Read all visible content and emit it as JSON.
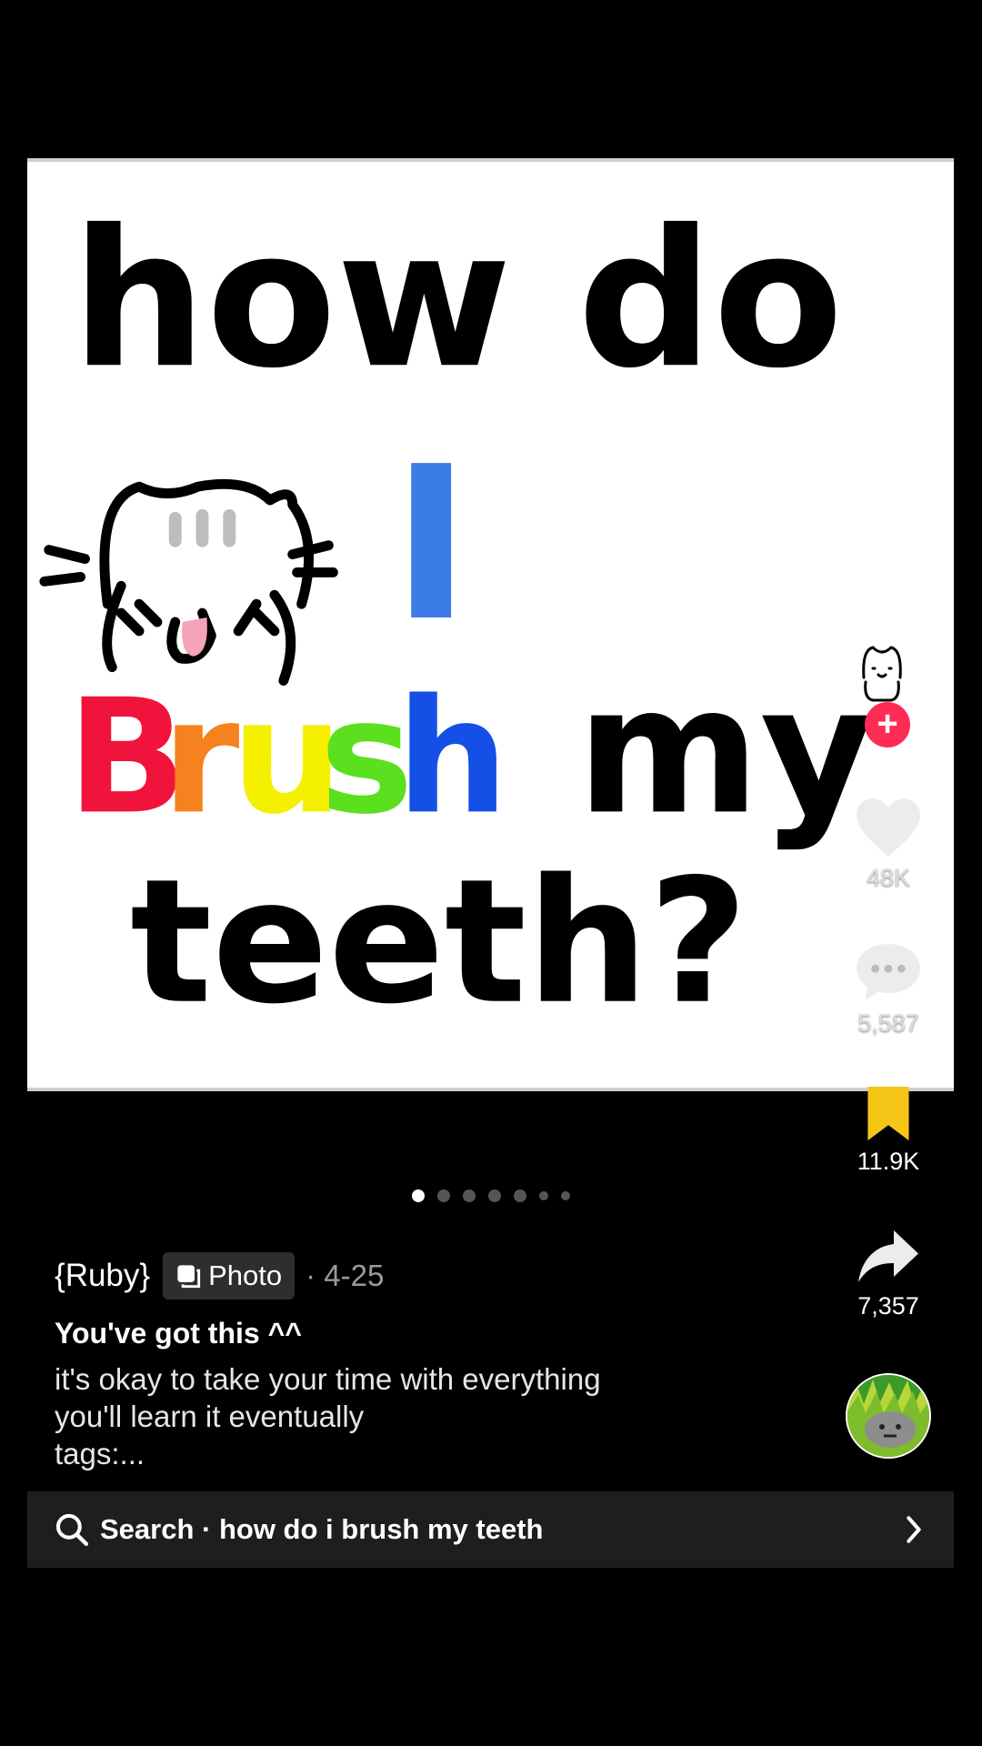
{
  "post": {
    "photo_text": {
      "line1": "how do",
      "line2": "I",
      "line3_colored": [
        "B",
        "r",
        "u",
        "s",
        "h"
      ],
      "line3_rest": "my",
      "line4": "teeth?"
    },
    "photo_colors": {
      "B": "#f0143c",
      "r": "#f5821e",
      "u": "#f5f000",
      "s": "#5ae01e",
      "h": "#1450e6",
      "I": "#3c7ce6"
    }
  },
  "rail": {
    "likes": "48K",
    "comments": "5,587",
    "saves": "11.9K",
    "shares": "7,357",
    "follow_symbol": "+",
    "save_color": "#f5c518",
    "follow_color": "#fe2c55"
  },
  "carousel": {
    "total_dots": 7,
    "active_index": 0
  },
  "meta": {
    "username": "{Ruby}",
    "badge_label": "Photo",
    "date": "· 4-25"
  },
  "caption": {
    "title": "You've got this ^^",
    "line1": "it's okay to take your time with everything",
    "line2": "you'll learn it eventually",
    "line3": "tags:..."
  },
  "search": {
    "label": "Search · how do i brush my teeth"
  }
}
